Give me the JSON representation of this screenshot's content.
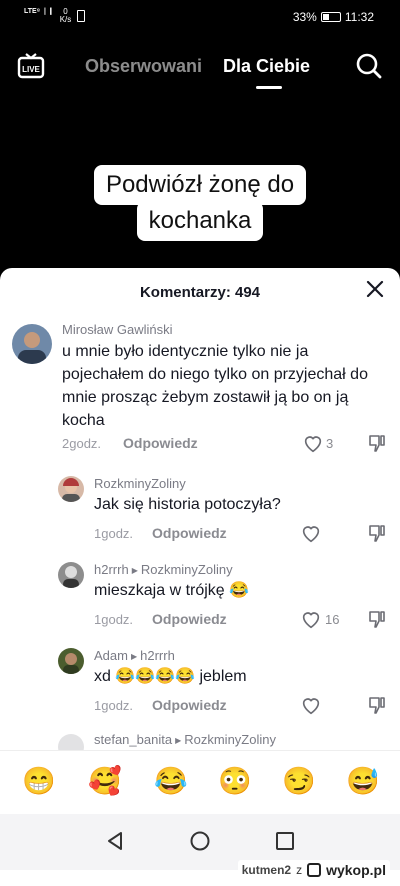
{
  "status": {
    "signal": "LTE⁸ ❘❙",
    "net_value": "0",
    "net_unit": "K/s",
    "battery_percent": "33%",
    "battery_level": 0.33,
    "time": "11:32"
  },
  "nav": {
    "live_label": "LIVE",
    "tab_following": "Obserwowani",
    "tab_for_you": "Dla Ciebie"
  },
  "video": {
    "caption_line1": "Podwiózł żonę do",
    "caption_line2": "kochanka"
  },
  "comments_panel": {
    "title": "Komentarzy: 494",
    "comments": [
      {
        "user": "Mirosław Gawliński",
        "text": "u mnie było identycznie tylko nie ja pojechałem do niego tylko on przyjechał do mnie prosząc żebym zostawił ją bo on ją kocha",
        "time": "2godz.",
        "reply": "Odpowiedz",
        "likes": "3"
      },
      {
        "user": "RozkminyZoliny",
        "text": "Jak się historia potoczyła?",
        "time": "1godz.",
        "reply": "Odpowiedz",
        "likes": ""
      },
      {
        "user": "h2rrrh",
        "reply_to": "RozkminyZoliny",
        "text": "mieszkaja w trójkę 😂",
        "time": "1godz.",
        "reply": "Odpowiedz",
        "likes": "16"
      },
      {
        "user": "Adam",
        "reply_to": "h2rrrh",
        "text": "xd 😂😂😂😂 jeblem",
        "time": "1godz.",
        "reply": "Odpowiedz",
        "likes": ""
      },
      {
        "user": "stefan_banita",
        "reply_to": "RozkminyZoliny"
      }
    ]
  },
  "emoji_bar": [
    "😁",
    "🥰",
    "😂",
    "😳",
    "😏",
    "😅"
  ],
  "watermark": {
    "user": "kutmen2",
    "sep": "z",
    "site": "wykop.pl"
  }
}
